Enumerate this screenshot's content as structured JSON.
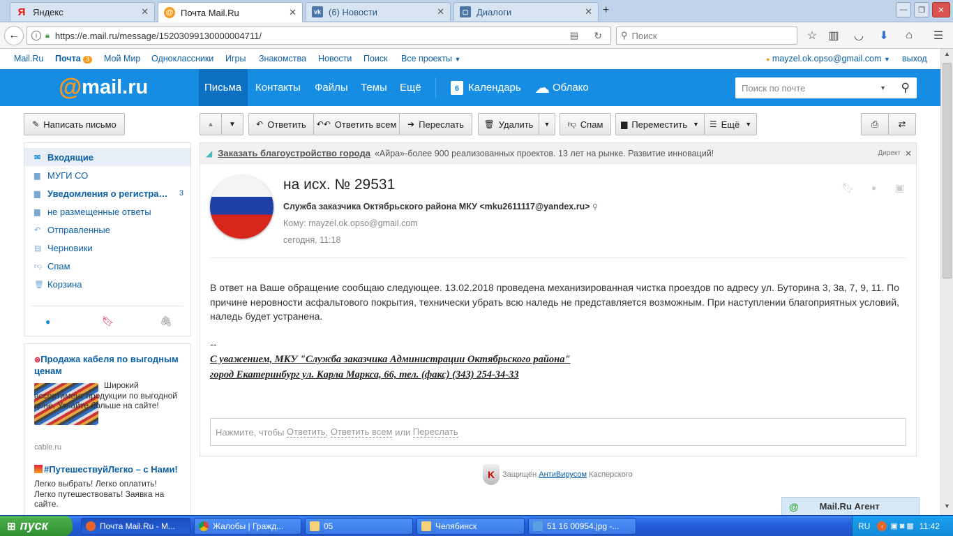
{
  "browser": {
    "tabs": [
      {
        "label": "Яндекс",
        "icon": "yandex-icon",
        "color": "#e61400"
      },
      {
        "label": "Почта Mail.Ru",
        "icon": "mailru-icon",
        "color": "#168de2"
      },
      {
        "label": "(6) Новости",
        "icon": "vk-icon",
        "color": "#4a76a8"
      },
      {
        "label": "Диалоги",
        "icon": "vk-dialogs-icon",
        "color": "#4a76a8"
      }
    ],
    "new_tab": "+",
    "url": "https://e.mail.ru/message/15203099130000004711/",
    "url_domain": "mail.ru",
    "search_placeholder": "Поиск"
  },
  "portal": {
    "links": [
      "Mail.Ru",
      "Почта",
      "Мой Мир",
      "Одноклассники",
      "Игры",
      "Знакомства",
      "Новости",
      "Поиск",
      "Все проекты"
    ],
    "mail_count": "3",
    "user_email": "mayzel.ok.opso@gmail.com",
    "logout": "выход"
  },
  "header": {
    "logo_at": "@",
    "logo_text": "mail.ru",
    "nav": [
      "Письма",
      "Контакты",
      "Файлы",
      "Темы",
      "Ещё"
    ],
    "calendar": "Календарь",
    "calendar_day": "6",
    "cloud": "Облако",
    "search_placeholder": "Поиск по почте"
  },
  "toolbar": {
    "compose": "Написать письмо",
    "reply": "Ответить",
    "reply_all": "Ответить всем",
    "forward": "Переслать",
    "delete": "Удалить",
    "spam": "Спам",
    "move": "Переместить",
    "more": "Ещё"
  },
  "folders": [
    {
      "label": "Входящие",
      "icon": "inbox-icon",
      "selected": true
    },
    {
      "label": "МУГИ СО",
      "icon": "folder-icon"
    },
    {
      "label": "Уведомления о регистра…",
      "icon": "folder-icon",
      "count": "3",
      "bold": true
    },
    {
      "label": "не размещенные ответы",
      "icon": "folder-icon"
    },
    {
      "label": "Отправленные",
      "icon": "sent-icon"
    },
    {
      "label": "Черновики",
      "icon": "drafts-icon"
    },
    {
      "label": "Спам",
      "icon": "spam-icon"
    },
    {
      "label": "Корзина",
      "icon": "trash-icon"
    }
  ],
  "ads": [
    {
      "title": "Продажа кабеля по выгодным ценам",
      "text": "Широкий ассортимент продукции по выгодной цене. Узнайте больше на сайте!",
      "domain": "cable.ru"
    },
    {
      "title": "#ПутешествуйЛегко – с Нами!",
      "text": "Легко выбрать! Легко оплатить! Легко путешествовать! Заявка на сайте."
    }
  ],
  "direct_ad": {
    "link": "Заказать благоустройство города",
    "text": "«Айра»-более 900 реализованных проектов. 13 лет на рынке. Развитие инноваций!",
    "label": "Директ"
  },
  "message": {
    "subject": "на исх. № 29531",
    "from": "Служба заказчика Октябрьского района МКУ <mku2611117@yandex.ru>",
    "to_label": "Кому:",
    "to": "mayzel.ok.opso@gmail.com",
    "date": "сегодня, 11:18",
    "body": "В ответ на Ваше обращение сообщаю следующее. 13.02.2018 проведена механизированная чистка проездов по адресу ул. Буторина 3, 3а, 7, 9, 11. По причине неровности асфальтового покрытия, технически убрать всю наледь не представляется возможным. При наступлении благоприятных условий, наледь будет устранена.",
    "sig_sep": "--",
    "sig1": "С уважением, МКУ \"Служба заказчика Администрации Октябрьского района\"",
    "sig2": "город Екатеринбург ул. Карла Маркса, 66, тел. (факс) (343) 254-34-33"
  },
  "quick_reply": {
    "prefix": "Нажмите, чтобы",
    "reply": "Ответить",
    "reply_all": "Ответить всем",
    "or": "или",
    "forward": "Переслать"
  },
  "protected": {
    "prefix": "Защищён",
    "link": "АнтиВирусом",
    "suffix": "Касперского"
  },
  "agent": "Mail.Ru Агент",
  "taskbar": {
    "start": "пуск",
    "tasks": [
      {
        "label": "Почта Mail.Ru - M...",
        "icon": "firefox-icon"
      },
      {
        "label": "Жалобы | Гражд...",
        "icon": "chrome-icon"
      },
      {
        "label": "05",
        "icon": "folder-icon"
      },
      {
        "label": "Челябинск",
        "icon": "folder-icon"
      },
      {
        "label": "51 16 00954.jpg -...",
        "icon": "image-viewer-icon"
      }
    ],
    "lang": "RU",
    "time": "11:42"
  },
  "colors": {
    "brand_blue": "#168de2",
    "brand_orange": "#f89a1c",
    "link": "#0a5fa8",
    "xp_blue": "#245edb"
  }
}
